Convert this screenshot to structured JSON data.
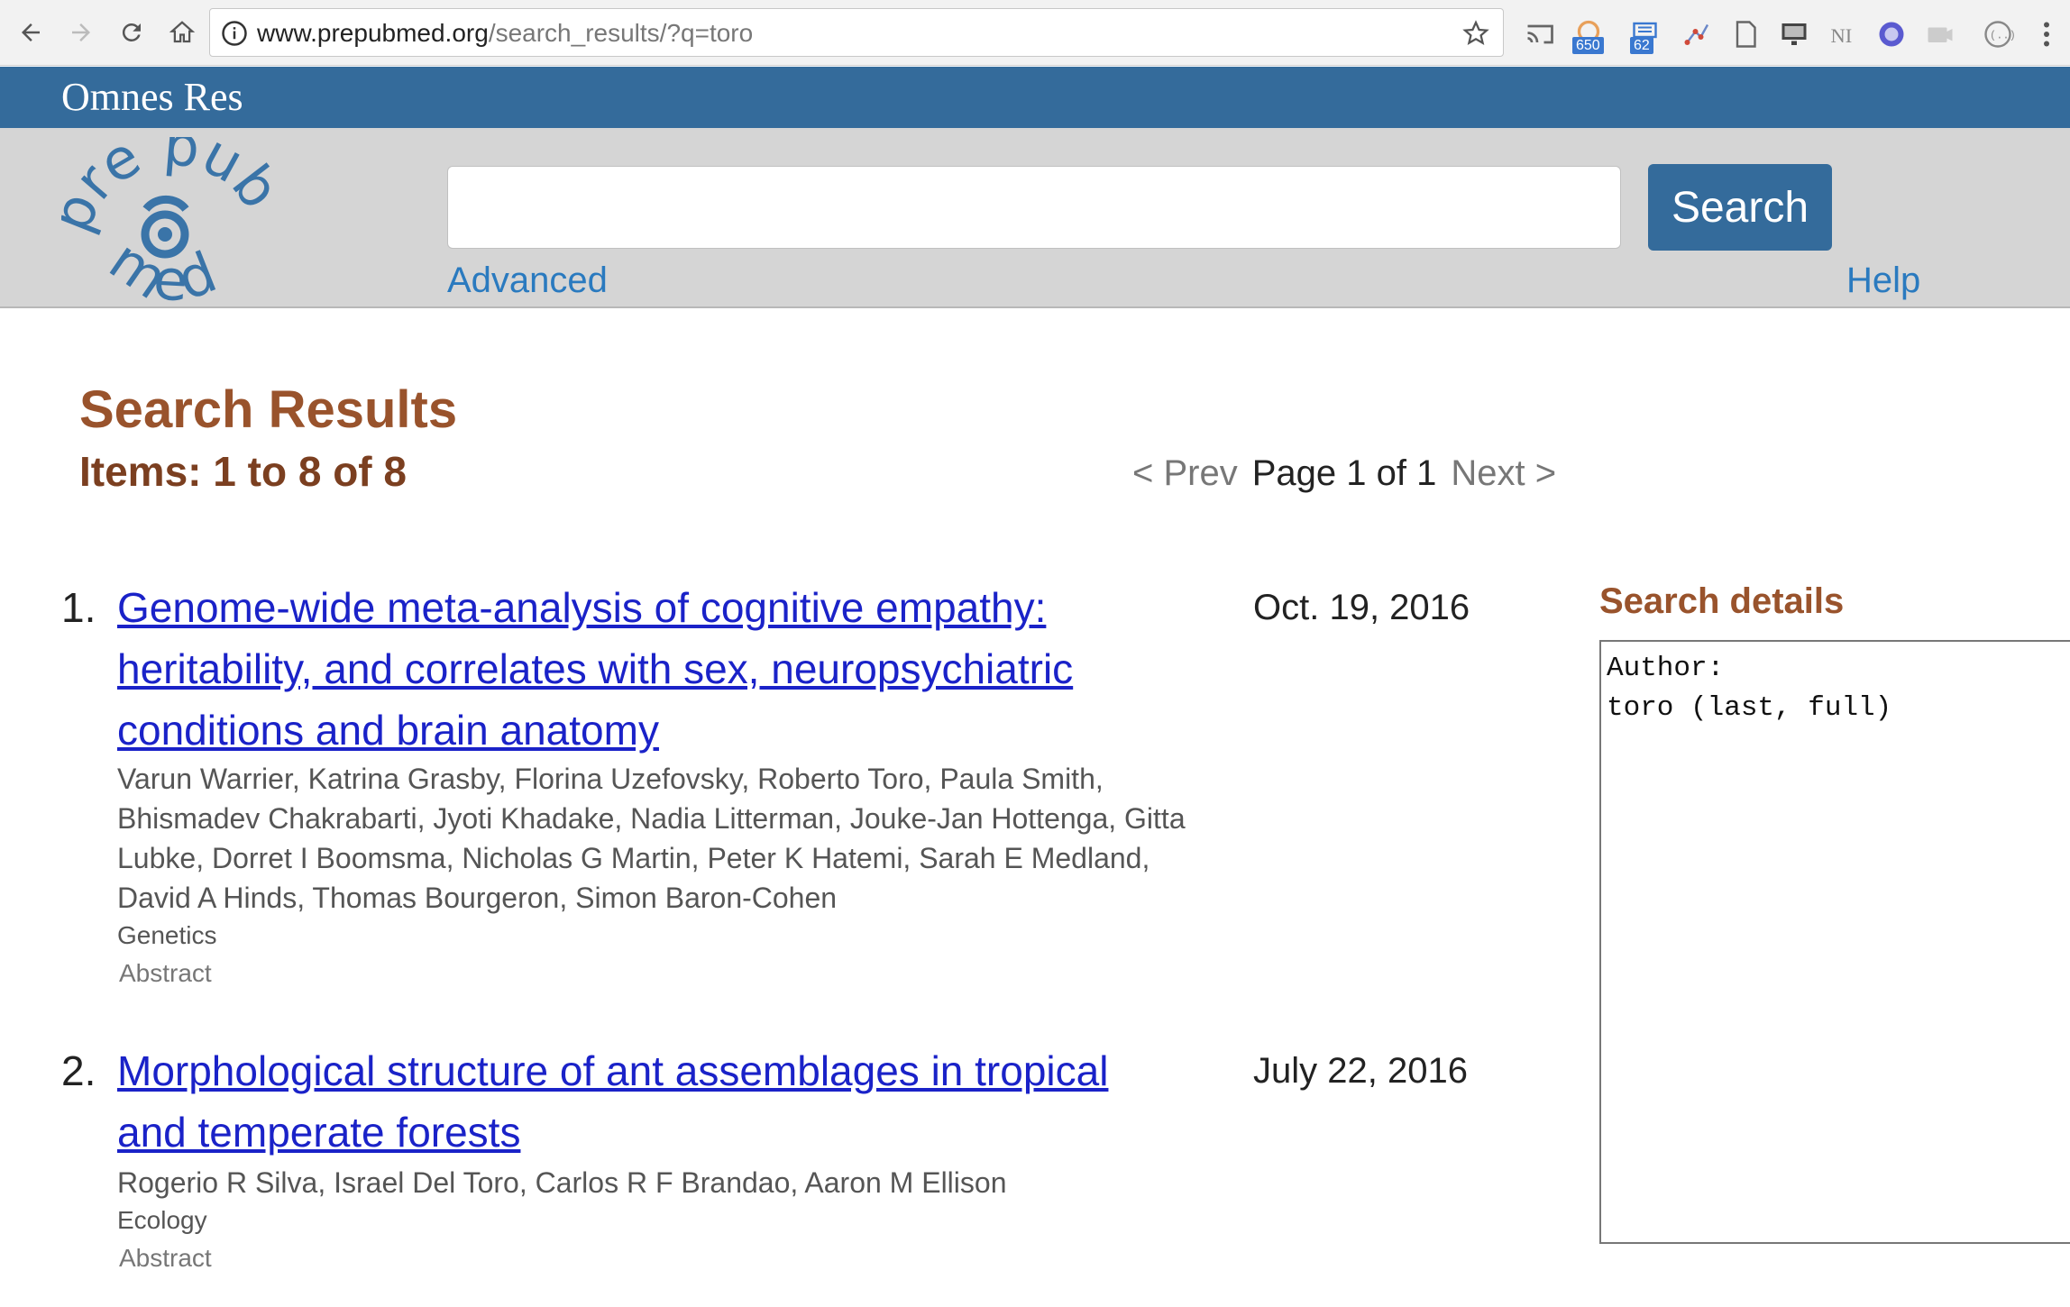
{
  "browser": {
    "url_host": "www.prepubmed.org",
    "url_path": "/search_results/?q=toro",
    "extensions": [
      {
        "icon": "cast-icon",
        "badge": ""
      },
      {
        "icon": "rss-icon",
        "badge": "650"
      },
      {
        "icon": "counter-icon",
        "badge": "62"
      },
      {
        "icon": "graph-icon",
        "badge": ""
      },
      {
        "icon": "document-icon",
        "badge": ""
      },
      {
        "icon": "monitor-icon",
        "badge": ""
      },
      {
        "icon": "ni-icon",
        "badge": ""
      },
      {
        "icon": "globe-icon",
        "badge": ""
      },
      {
        "icon": "camera-icon",
        "badge": ""
      },
      {
        "icon": "ellipsis-circle-icon",
        "badge": ""
      }
    ]
  },
  "header": {
    "brand": "Omnes Res",
    "logo_text": {
      "pre": "pre",
      "pub": "pub",
      "med": "med"
    }
  },
  "search": {
    "query_value": "",
    "button_label": "Search",
    "advanced_label": "Advanced",
    "help_label": "Help"
  },
  "results": {
    "title": "Search Results",
    "items_label": "Items: 1 to 8 of 8",
    "pager": {
      "prev": "< Prev",
      "current": "Page 1 of 1",
      "next": "Next >"
    },
    "list": [
      {
        "number": "1.",
        "title": "Genome-wide meta-analysis of cognitive empathy: heritability, and correlates with sex, neuropsychiatric conditions and brain anatomy",
        "date": "Oct. 19, 2016",
        "authors": "Varun Warrier, Katrina Grasby, Florina Uzefovsky, Roberto Toro, Paula Smith, Bhismadev Chakrabarti, Jyoti Khadake, Nadia Litterman, Jouke-Jan Hottenga, Gitta Lubke, Dorret I Boomsma, Nicholas G Martin, Peter K Hatemi, Sarah E Medland, David A Hinds, Thomas Bourgeron, Simon Baron-Cohen",
        "category": "Genetics",
        "abstract_label": "Abstract"
      },
      {
        "number": "2.",
        "title": "Morphological structure of ant assemblages in tropical and temperate forests",
        "date": "July 22, 2016",
        "authors": "Rogerio R Silva, Israel Del Toro, Carlos R F Brandao, Aaron M Ellison",
        "category": "Ecology",
        "abstract_label": "Abstract"
      }
    ]
  },
  "details": {
    "heading": "Search details",
    "content": "Author:\ntoro (last, full)"
  },
  "colors": {
    "brand_bar": "#346b9b",
    "heading_brown": "#99532c",
    "link_blue": "#1a22c8",
    "accent_blue": "#2a7abf"
  }
}
